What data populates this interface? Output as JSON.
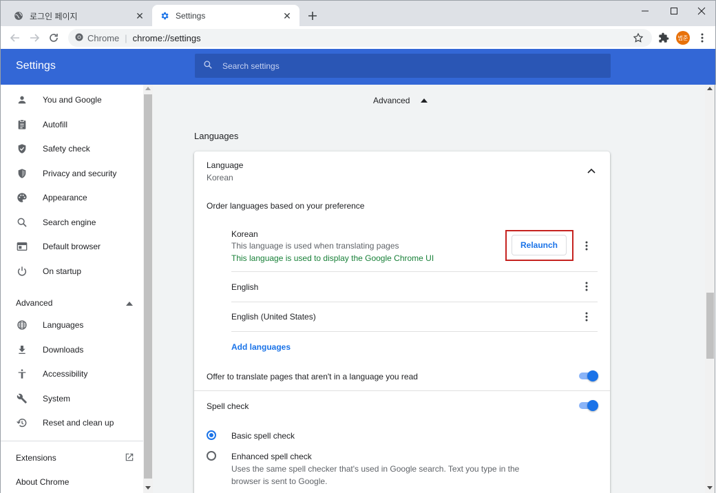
{
  "tabs": [
    {
      "title": "로그인 페이지",
      "icon": "globe-icon",
      "active": false
    },
    {
      "title": "Settings",
      "icon": "gear-icon",
      "active": true
    }
  ],
  "toolbar": {
    "origin_label": "Chrome",
    "url": "chrome://settings",
    "profile_initials": "범준"
  },
  "header": {
    "title": "Settings",
    "search_placeholder": "Search settings"
  },
  "sidebar": {
    "items": [
      {
        "label": "You and Google",
        "icon": "person-icon"
      },
      {
        "label": "Autofill",
        "icon": "clipboard-icon"
      },
      {
        "label": "Safety check",
        "icon": "shield-check-icon"
      },
      {
        "label": "Privacy and security",
        "icon": "shield-icon"
      },
      {
        "label": "Appearance",
        "icon": "palette-icon"
      },
      {
        "label": "Search engine",
        "icon": "search-icon"
      },
      {
        "label": "Default browser",
        "icon": "browser-icon"
      },
      {
        "label": "On startup",
        "icon": "power-icon"
      }
    ],
    "advanced_label": "Advanced",
    "advanced_items": [
      {
        "label": "Languages",
        "icon": "globe-icon"
      },
      {
        "label": "Downloads",
        "icon": "download-icon"
      },
      {
        "label": "Accessibility",
        "icon": "accessibility-icon"
      },
      {
        "label": "System",
        "icon": "wrench-icon"
      },
      {
        "label": "Reset and clean up",
        "icon": "history-icon"
      }
    ],
    "extensions_label": "Extensions",
    "about_label": "About Chrome"
  },
  "main": {
    "advanced_toggle": "Advanced",
    "section_title": "Languages",
    "language_label": "Language",
    "language_value": "Korean",
    "order_label": "Order languages based on your preference",
    "languages": [
      {
        "name": "Korean",
        "note1": "This language is used when translating pages",
        "note2": "This language is used to display the Google Chrome UI",
        "action": "Relaunch"
      },
      {
        "name": "English"
      },
      {
        "name": "English (United States)"
      }
    ],
    "add_languages": "Add languages",
    "offer_translate": "Offer to translate pages that aren't in a language you read",
    "offer_translate_on": true,
    "spell_check": "Spell check",
    "spell_check_on": true,
    "basic_spell": "Basic spell check",
    "enhanced_spell": "Enhanced spell check",
    "enhanced_desc_1": "Uses the same spell checker that's used in Google search. Text you type in the",
    "enhanced_desc_2": "browser is sent to Google.",
    "selected_spell": "basic"
  },
  "colors": {
    "header_blue": "#3367d6",
    "accent": "#1a73e8",
    "green_text": "#188038",
    "highlight_box": "#c5221f"
  }
}
